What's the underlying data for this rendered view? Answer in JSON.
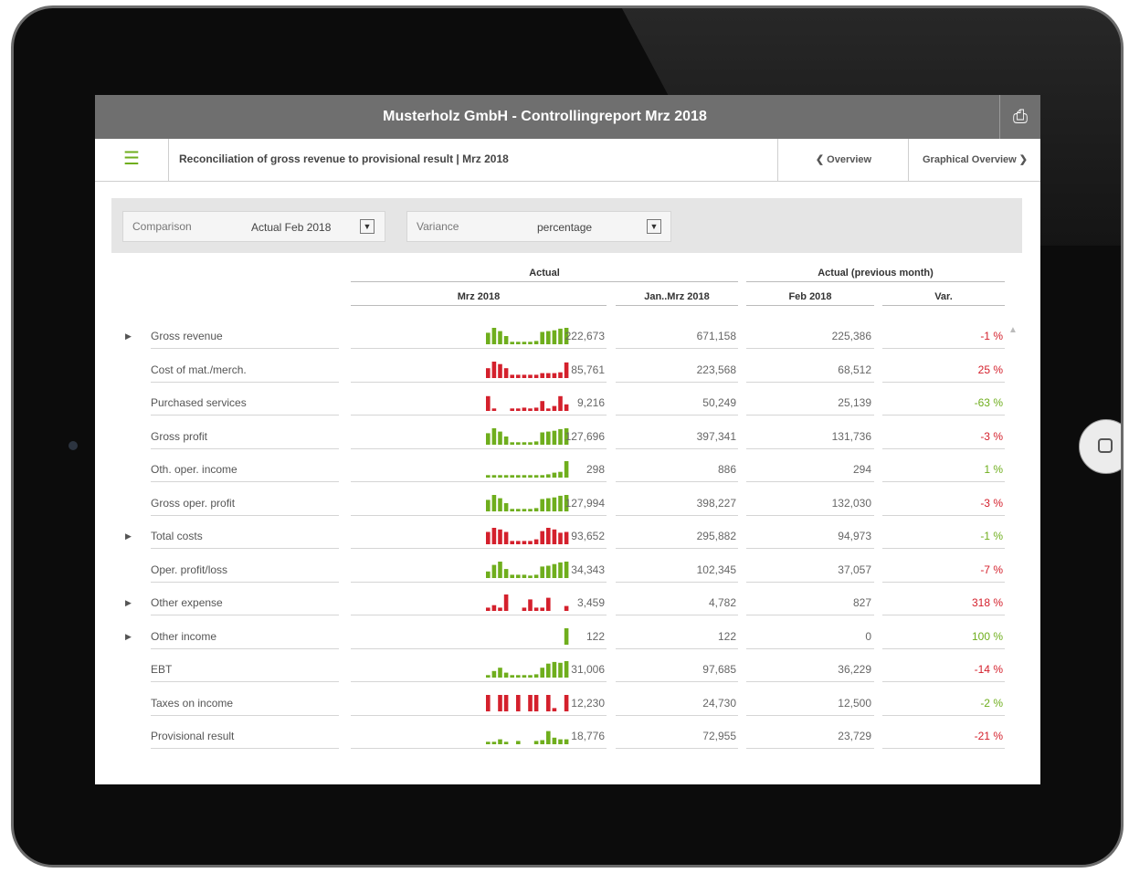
{
  "window": {
    "title": "Musterholz GmbH - Controllingreport Mrz 2018",
    "print_icon": "printer-icon"
  },
  "nav": {
    "menu_icon": "hamburger-menu-icon",
    "subtitle": "Reconciliation of gross revenue to provisional result | Mrz 2018",
    "overview": "❮ Overview",
    "graphical": "Graphical Overview ❯"
  },
  "filters": {
    "comparison_label": "Comparison",
    "comparison_value": "Actual Feb 2018",
    "variance_label": "Variance",
    "variance_value": "percentage"
  },
  "table": {
    "group_actual": "Actual",
    "group_prev": "Actual (previous month)",
    "col_mrz": "Mrz 2018",
    "col_ytd": "Jan..Mrz 2018",
    "col_feb": "Feb 2018",
    "col_var": "Var.",
    "rows": [
      {
        "label": "Gross revenue",
        "expand": true,
        "value": "222,673",
        "ytd": "671,158",
        "prev": "225,386",
        "var": "-1 %",
        "var_color": "#d4202c",
        "spark_color": "#6fae1d",
        "spark": [
          0.7,
          1,
          0.8,
          0.5,
          0.15,
          0.15,
          0.15,
          0.15,
          0.2,
          0.75,
          0.8,
          0.85,
          0.95,
          1
        ]
      },
      {
        "label": "Cost of mat./merch.",
        "expand": false,
        "value": "85,761",
        "ytd": "223,568",
        "prev": "68,512",
        "var": "25 %",
        "var_color": "#d4202c",
        "spark_color": "#d4202c",
        "spark": [
          0.6,
          1,
          0.85,
          0.6,
          0.2,
          0.2,
          0.2,
          0.2,
          0.2,
          0.3,
          0.3,
          0.3,
          0.35,
          0.95
        ]
      },
      {
        "label": "Purchased services",
        "expand": false,
        "value": "9,216",
        "ytd": "50,249",
        "prev": "25,139",
        "var": "-63 %",
        "var_color": "#6fae1d",
        "spark_color": "#d4202c",
        "spark": [
          0.9,
          0.15,
          0,
          0,
          0.15,
          0.15,
          0.2,
          0.15,
          0.2,
          0.6,
          0.15,
          0.3,
          0.9,
          0.4
        ]
      },
      {
        "label": "Gross profit",
        "expand": false,
        "value": "127,696",
        "ytd": "397,341",
        "prev": "131,736",
        "var": "-3 %",
        "var_color": "#d4202c",
        "spark_color": "#6fae1d",
        "spark": [
          0.7,
          1,
          0.8,
          0.5,
          0.15,
          0.15,
          0.15,
          0.15,
          0.2,
          0.75,
          0.8,
          0.85,
          0.95,
          1
        ]
      },
      {
        "label": "Oth. oper. income",
        "expand": false,
        "value": "298",
        "ytd": "886",
        "prev": "294",
        "var": "1 %",
        "var_color": "#6fae1d",
        "spark_color": "#6fae1d",
        "spark": [
          0.15,
          0.15,
          0.15,
          0.15,
          0.15,
          0.15,
          0.15,
          0.15,
          0.15,
          0.15,
          0.2,
          0.3,
          0.35,
          1
        ]
      },
      {
        "label": "Gross oper. profit",
        "expand": false,
        "value": "127,994",
        "ytd": "398,227",
        "prev": "132,030",
        "var": "-3 %",
        "var_color": "#d4202c",
        "spark_color": "#6fae1d",
        "spark": [
          0.7,
          1,
          0.8,
          0.5,
          0.15,
          0.15,
          0.15,
          0.15,
          0.2,
          0.75,
          0.8,
          0.85,
          0.95,
          1
        ]
      },
      {
        "label": "Total costs",
        "expand": true,
        "value": "93,652",
        "ytd": "295,882",
        "prev": "94,973",
        "var": "-1 %",
        "var_color": "#6fae1d",
        "spark_color": "#d4202c",
        "spark": [
          0.75,
          1,
          0.9,
          0.75,
          0.2,
          0.2,
          0.2,
          0.2,
          0.3,
          0.8,
          1,
          0.9,
          0.7,
          0.75
        ]
      },
      {
        "label": "Oper. profit/loss",
        "expand": false,
        "value": "34,343",
        "ytd": "102,345",
        "prev": "37,057",
        "var": "-7 %",
        "var_color": "#d4202c",
        "spark_color": "#6fae1d",
        "spark": [
          0.4,
          0.8,
          1,
          0.55,
          0.2,
          0.2,
          0.2,
          0.15,
          0.2,
          0.7,
          0.75,
          0.85,
          0.95,
          1
        ]
      },
      {
        "label": "Other expense",
        "expand": true,
        "value": "3,459",
        "ytd": "4,782",
        "prev": "827",
        "var": "318 %",
        "var_color": "#d4202c",
        "spark_color": "#d4202c",
        "spark": [
          0.2,
          0.35,
          0.2,
          1,
          0,
          0,
          0.2,
          0.7,
          0.2,
          0.2,
          0.8,
          0,
          0,
          0.3
        ]
      },
      {
        "label": "Other income",
        "expand": true,
        "value": "122",
        "ytd": "122",
        "prev": "0",
        "var": "100 %",
        "var_color": "#6fae1d",
        "spark_color": "#6fae1d",
        "spark": [
          0,
          0,
          0,
          0,
          0,
          0,
          0,
          0,
          0,
          0,
          0,
          0,
          0,
          1
        ]
      },
      {
        "label": "EBT",
        "expand": false,
        "value": "31,006",
        "ytd": "97,685",
        "prev": "36,229",
        "var": "-14 %",
        "var_color": "#d4202c",
        "spark_color": "#6fae1d",
        "spark": [
          0.15,
          0.4,
          0.6,
          0.3,
          0.15,
          0.15,
          0.15,
          0.15,
          0.2,
          0.6,
          0.85,
          0.95,
          0.9,
          1
        ]
      },
      {
        "label": "Taxes on income",
        "expand": false,
        "value": "12,230",
        "ytd": "24,730",
        "prev": "12,500",
        "var": "-2 %",
        "var_color": "#6fae1d",
        "spark_color": "#d4202c",
        "spark": [
          1,
          0,
          1,
          1,
          0,
          1,
          0,
          1,
          1,
          0,
          1,
          0.2,
          0,
          1
        ]
      },
      {
        "label": "Provisional result",
        "expand": false,
        "value": "18,776",
        "ytd": "72,955",
        "prev": "23,729",
        "var": "-21 %",
        "var_color": "#d4202c",
        "spark_color": "#6fae1d",
        "spark": [
          0.15,
          0.15,
          0.3,
          0.15,
          0,
          0.2,
          0,
          0,
          0.2,
          0.25,
          0.8,
          0.4,
          0.3,
          0.3
        ]
      }
    ]
  }
}
